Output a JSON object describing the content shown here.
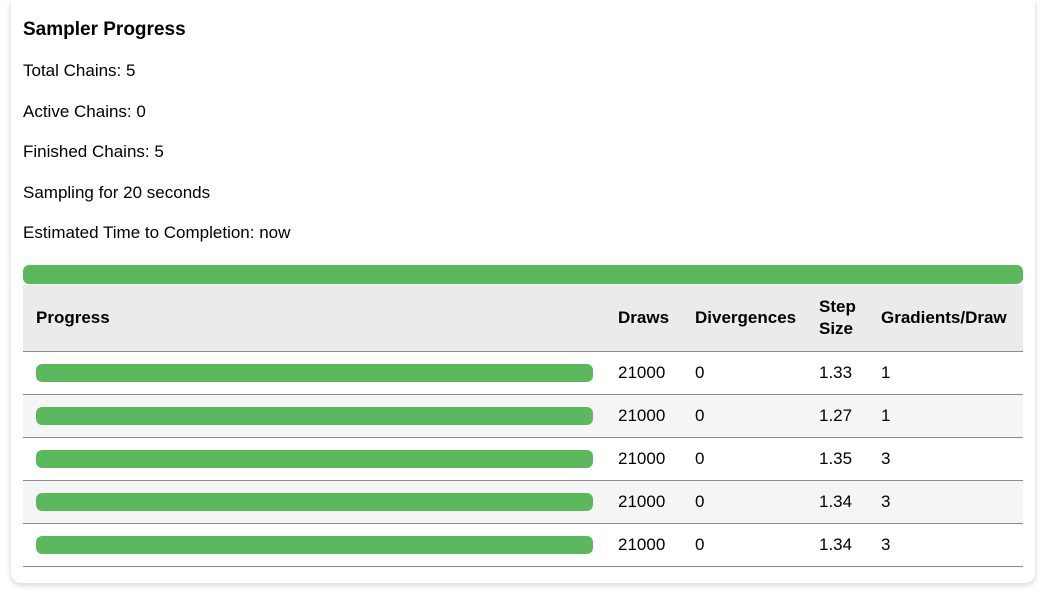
{
  "title": "Sampler Progress",
  "stats": {
    "total_chains": "Total Chains: 5",
    "active_chains": "Active Chains: 0",
    "finished_chains": "Finished Chains: 5",
    "sampling_time": "Sampling for 20 seconds",
    "eta": "Estimated Time to Completion: now"
  },
  "overall_progress": 1.0,
  "colors": {
    "progress_fill": "#5cb85c",
    "progress_track": "#e6e6e6",
    "header_bg": "#ebebeb"
  },
  "table": {
    "headers": {
      "progress": "Progress",
      "draws": "Draws",
      "divergences": "Divergences",
      "step_size_line1": "Step",
      "step_size_line2": "Size",
      "gradients": "Gradients/Draw"
    },
    "rows": [
      {
        "progress": 1.0,
        "draws": "21000",
        "divergences": "0",
        "step_size": "1.33",
        "gradients": "1"
      },
      {
        "progress": 1.0,
        "draws": "21000",
        "divergences": "0",
        "step_size": "1.27",
        "gradients": "1"
      },
      {
        "progress": 1.0,
        "draws": "21000",
        "divergences": "0",
        "step_size": "1.35",
        "gradients": "3"
      },
      {
        "progress": 1.0,
        "draws": "21000",
        "divergences": "0",
        "step_size": "1.34",
        "gradients": "3"
      },
      {
        "progress": 1.0,
        "draws": "21000",
        "divergences": "0",
        "step_size": "1.34",
        "gradients": "3"
      }
    ]
  }
}
